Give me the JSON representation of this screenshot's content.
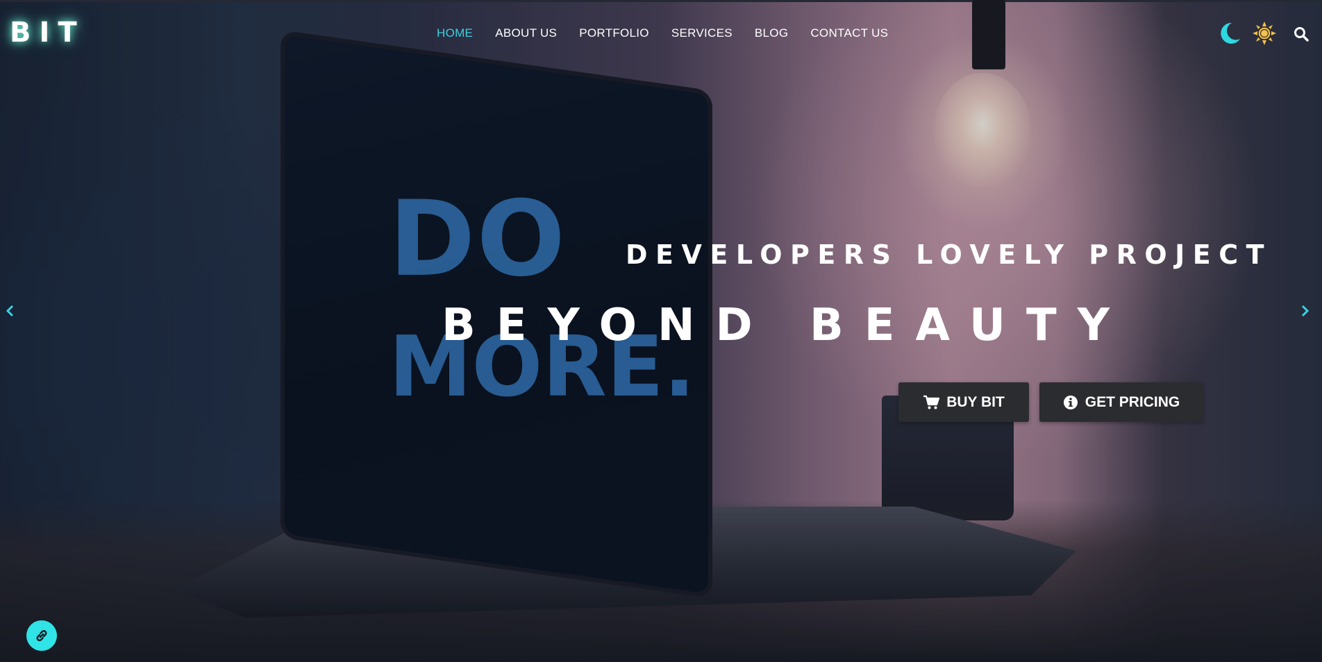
{
  "brand": {
    "logo_text": "BIT"
  },
  "nav": {
    "items": [
      {
        "label": "HOME",
        "active": true
      },
      {
        "label": "ABOUT US",
        "active": false
      },
      {
        "label": "PORTFOLIO",
        "active": false
      },
      {
        "label": "SERVICES",
        "active": false
      },
      {
        "label": "BLOG",
        "active": false
      },
      {
        "label": "CONTACT US",
        "active": false
      }
    ]
  },
  "header_icons": {
    "dark_mode": "moon-icon",
    "light_mode": "sun-icon",
    "search": "search-icon"
  },
  "hero": {
    "tagline": "DEVELOPERS LOVELY PROJECT",
    "headline": "BEYOND BEAUTY",
    "screen_text_line1": "DO",
    "screen_text_line2": "MORE.",
    "buttons": {
      "buy_label": "BUY BIT",
      "buy_icon": "cart-icon",
      "pricing_label": "GET PRICING",
      "pricing_icon": "info-icon"
    },
    "slider": {
      "prev_icon": "chevron-left-icon",
      "next_icon": "chevron-right-icon"
    }
  },
  "floating": {
    "link_icon": "link-icon"
  },
  "colors": {
    "accent": "#3dd0e0",
    "moon": "#2fd8e0",
    "sun": "#f2c14e",
    "button_bg": "#2b2c30",
    "fab_bg": "#2fe3e6"
  }
}
